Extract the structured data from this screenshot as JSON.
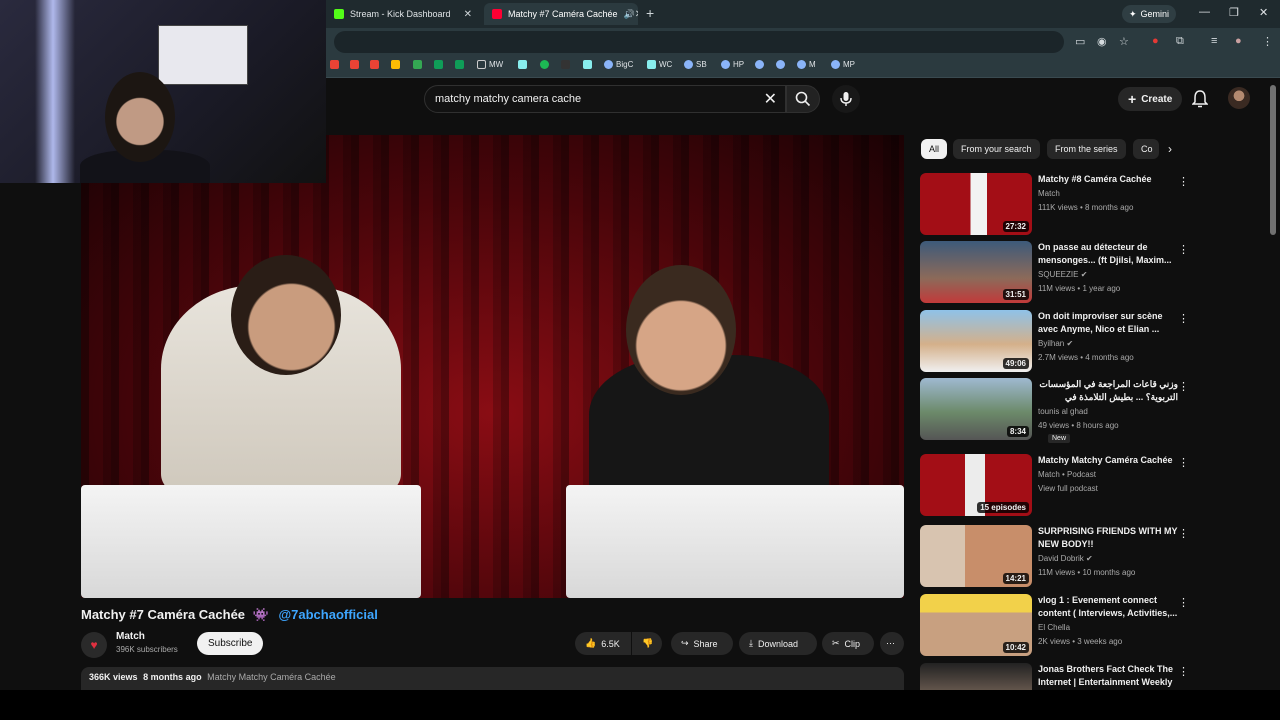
{
  "browser": {
    "tabs": [
      {
        "label": "Stream - Kick Dashboard",
        "icon": "kick-icon",
        "color": "#53fc18"
      },
      {
        "label": "Matchy #7 Caméra Cachée",
        "icon": "youtube-icon",
        "color": "#ff0033"
      }
    ],
    "gemini_label": "Gemini",
    "bookmarks": [
      "MW",
      "BigC",
      "WC",
      "SB",
      "HP",
      "M",
      "MP"
    ]
  },
  "youtube": {
    "search": {
      "query": "matchy matchy camera cache"
    },
    "create_label": "Create",
    "video": {
      "title": "Matchy #7 Caméra Cachée",
      "tag": "@7abchaofficial",
      "channel": "Match",
      "subscribers": "396K subscribers",
      "subscribe_label": "Subscribe",
      "likes": "6.5K",
      "share_label": "Share",
      "download_label": "Download",
      "clip_label": "Clip",
      "views": "366K views",
      "age": "8 months ago",
      "playlist": "Matchy Matchy Caméra Cachée"
    },
    "chips": [
      "All",
      "From your search",
      "From the series",
      "Co"
    ],
    "recommendations": [
      {
        "title": "Matchy #8 Caméra Cachée",
        "channel": "Match",
        "meta": "111K views • 8 months ago",
        "duration": "27:32"
      },
      {
        "title": "On passe au détecteur de mensonges... (ft Djilsi, Maxim...",
        "channel": "SQUEEZIE",
        "meta": "11M views • 1 year ago",
        "duration": "31:51"
      },
      {
        "title": "On doit improviser sur scène avec Anyme, Nico et Elian ...",
        "channel": "Byilhan",
        "meta": "2.7M views • 4 months ago",
        "duration": "49:06"
      },
      {
        "title": "وزني قاعات المراجعة في المؤسسات التربوية؟ ... بطيش التلامذة في الشارع في أحسان",
        "channel": "tounis al ghad",
        "meta": "49 views • 8 hours ago",
        "duration": "8:34",
        "badge": "New"
      },
      {
        "title": "Matchy Matchy Caméra Cachée",
        "channel": "Match • Podcast",
        "meta": "View full podcast",
        "duration": "15 episodes"
      },
      {
        "title": "SURPRISING FRIENDS WITH MY NEW BODY!!",
        "channel": "David Dobrik",
        "meta": "11M views • 10 months ago",
        "duration": "14:21"
      },
      {
        "title": "vlog 1 : Evenement connect content ( Interviews, Activities,...",
        "channel": "El Chella",
        "meta": "2K views • 3 weeks ago",
        "duration": "10:42"
      },
      {
        "title": "Jonas Brothers Fact Check The Internet | Entertainment Weekly",
        "channel": "",
        "meta": "",
        "duration": ""
      }
    ]
  }
}
